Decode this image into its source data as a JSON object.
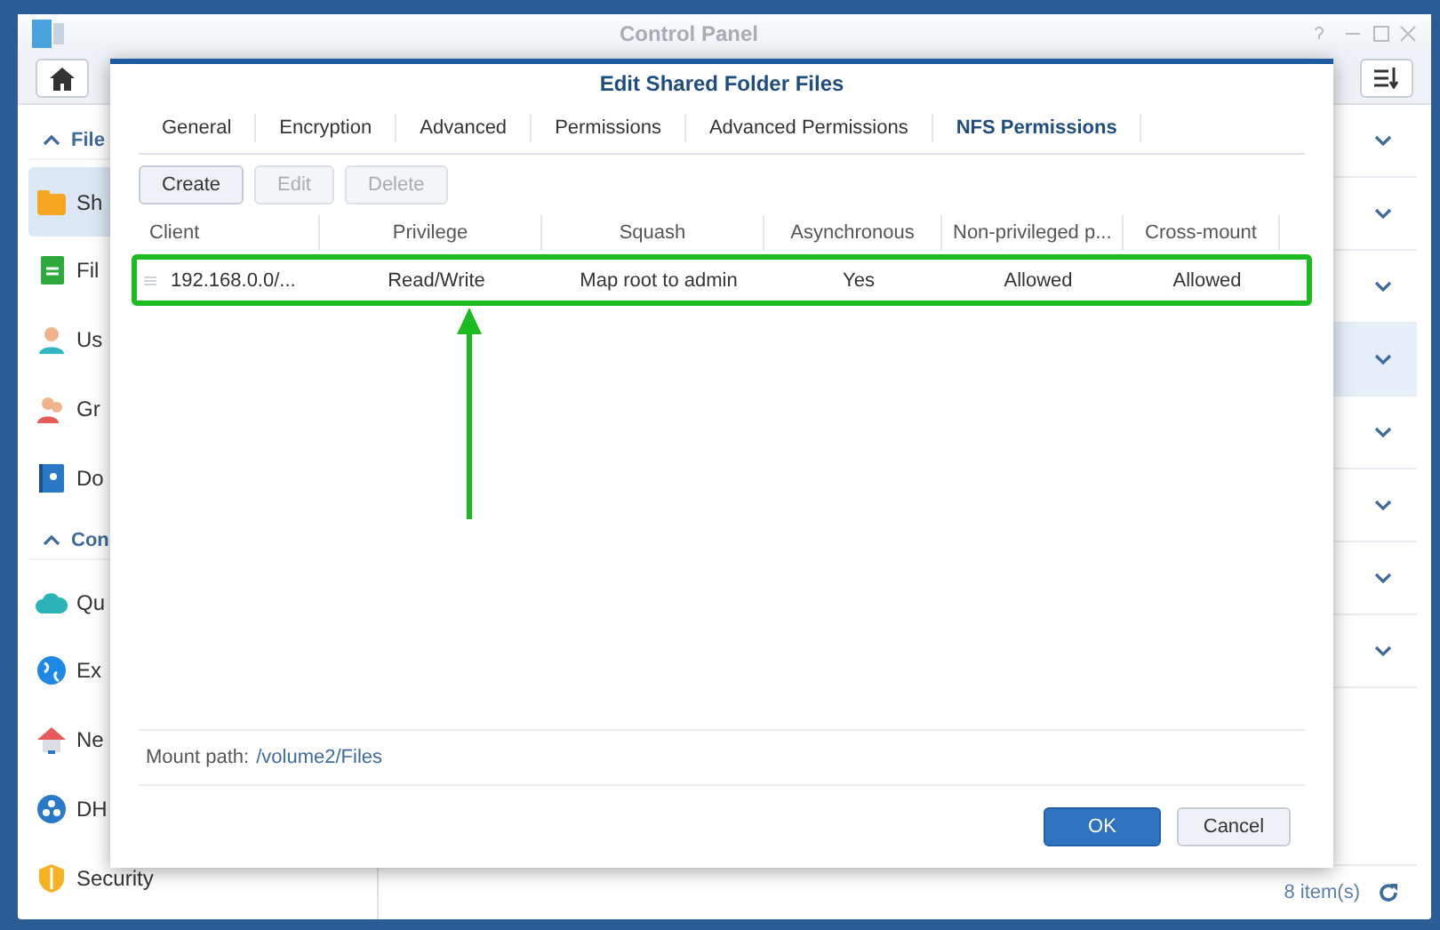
{
  "window": {
    "title": "Control Panel"
  },
  "sidebar": {
    "sections": [
      {
        "label": "File",
        "expanded": true,
        "items": [
          {
            "label": "Sh",
            "selected": true
          },
          {
            "label": "Fil",
            "selected": false
          },
          {
            "label": "Us",
            "selected": false
          },
          {
            "label": "Gr",
            "selected": false
          },
          {
            "label": "Do",
            "selected": false
          }
        ]
      },
      {
        "label": "Con",
        "expanded": true,
        "items": [
          {
            "label": "Qu",
            "selected": false
          },
          {
            "label": "Ex",
            "selected": false
          },
          {
            "label": "Ne",
            "selected": false
          },
          {
            "label": "DH",
            "selected": false
          },
          {
            "label": "Security",
            "selected": false
          }
        ]
      }
    ]
  },
  "list": {
    "rows": [
      {
        "selected": false
      },
      {
        "selected": false
      },
      {
        "selected": false
      },
      {
        "selected": true
      },
      {
        "selected": false
      },
      {
        "selected": false
      },
      {
        "selected": false
      },
      {
        "selected": false
      }
    ],
    "count": "8 item(s)"
  },
  "dialog": {
    "title": "Edit Shared Folder Files",
    "tabs": [
      {
        "label": "General",
        "selected": false
      },
      {
        "label": "Encryption",
        "selected": false
      },
      {
        "label": "Advanced",
        "selected": false
      },
      {
        "label": "Permissions",
        "selected": false
      },
      {
        "label": "Advanced Permissions",
        "selected": false
      },
      {
        "label": "NFS Permissions",
        "selected": true
      }
    ],
    "toolbar": [
      {
        "label": "Create",
        "disabled": false
      },
      {
        "label": "Edit",
        "disabled": true
      },
      {
        "label": "Delete",
        "disabled": true
      }
    ],
    "table": {
      "columns": [
        "Client",
        "Privilege",
        "Squash",
        "Asynchronous",
        "Non-privileged p...",
        "Cross-mount"
      ],
      "rows": [
        {
          "highlighted": true,
          "cells": [
            "192.168.0.0/...",
            "Read/Write",
            "Map root to admin",
            "Yes",
            "Allowed",
            "Allowed"
          ]
        }
      ]
    },
    "mount_path": {
      "label": "Mount path:",
      "value": "/volume2/Files"
    },
    "buttons": [
      {
        "label": "OK",
        "kind": "primary"
      },
      {
        "label": "Cancel",
        "kind": "secondary"
      }
    ]
  }
}
